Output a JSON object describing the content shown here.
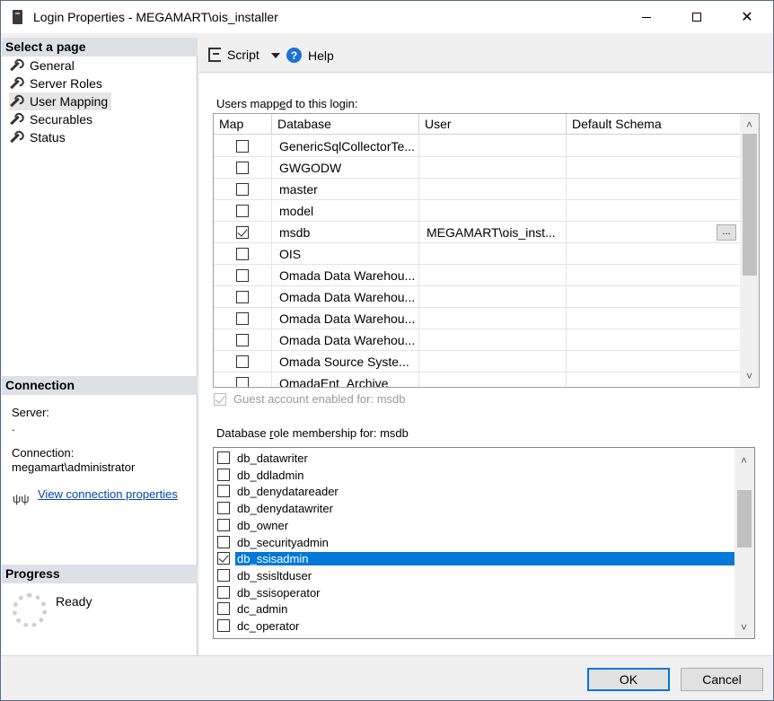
{
  "window": {
    "title": "Login Properties - MEGAMART\\ois_installer"
  },
  "left": {
    "select_page_header": "Select a page",
    "nav_items": [
      {
        "label": "General"
      },
      {
        "label": "Server Roles"
      },
      {
        "label": "User Mapping"
      },
      {
        "label": "Securables"
      },
      {
        "label": "Status"
      }
    ],
    "selected_nav": "User Mapping",
    "connection_header": "Connection",
    "server_label": "Server:",
    "server_value": ".",
    "connection_label": "Connection:",
    "connection_value": "megamart\\administrator",
    "view_connection_link": "View connection properties",
    "progress_header": "Progress",
    "progress_status": "Ready"
  },
  "toolbar": {
    "script_label": "Script",
    "help_label": "Help"
  },
  "mapping": {
    "label_pre": "Users mapp",
    "label_u": "e",
    "label_post": "d to this login:",
    "columns": [
      "Map",
      "Database",
      "User",
      "Default Schema"
    ],
    "rows": [
      {
        "checked": false,
        "database": "GenericSqlCollectorTe...",
        "user": "",
        "schema": ""
      },
      {
        "checked": false,
        "database": "GWGODW",
        "user": "",
        "schema": ""
      },
      {
        "checked": false,
        "database": "master",
        "user": "",
        "schema": ""
      },
      {
        "checked": false,
        "database": "model",
        "user": "",
        "schema": ""
      },
      {
        "checked": true,
        "database": "msdb",
        "user": "MEGAMART\\ois_inst...",
        "schema": "",
        "ellipsis": "..."
      },
      {
        "checked": false,
        "database": "OIS",
        "user": "",
        "schema": ""
      },
      {
        "checked": false,
        "database": "Omada Data Warehou...",
        "user": "",
        "schema": ""
      },
      {
        "checked": false,
        "database": "Omada Data Warehou...",
        "user": "",
        "schema": ""
      },
      {
        "checked": false,
        "database": "Omada Data Warehou...",
        "user": "",
        "schema": ""
      },
      {
        "checked": false,
        "database": "Omada Data Warehou...",
        "user": "",
        "schema": ""
      },
      {
        "checked": false,
        "database": "Omada Source Syste...",
        "user": "",
        "schema": ""
      },
      {
        "checked": false,
        "database": "OmadaEnt_Archive",
        "user": "",
        "schema": ""
      }
    ],
    "guest_label": "Guest account enabled for: msdb",
    "guest_checked": true
  },
  "roles": {
    "label_pre": "Database ",
    "label_u": "r",
    "label_post": "ole membership for: msdb",
    "items": [
      {
        "name": "db_datawriter",
        "checked": false
      },
      {
        "name": "db_ddladmin",
        "checked": false
      },
      {
        "name": "db_denydatareader",
        "checked": false
      },
      {
        "name": "db_denydatawriter",
        "checked": false
      },
      {
        "name": "db_owner",
        "checked": false
      },
      {
        "name": "db_securityadmin",
        "checked": false
      },
      {
        "name": "db_ssisadmin",
        "checked": true
      },
      {
        "name": "db_ssisltduser",
        "checked": false
      },
      {
        "name": "db_ssisoperator",
        "checked": false
      },
      {
        "name": "dc_admin",
        "checked": false
      },
      {
        "name": "dc_operator",
        "checked": false
      }
    ],
    "selected": "db_ssisadmin"
  },
  "footer": {
    "ok_label": "OK",
    "cancel_label": "Cancel"
  },
  "colors": {
    "accent": "#0078d7",
    "link": "#0645ad"
  },
  "icons": {
    "app": "server-icon",
    "nav": "wrench-icon",
    "script": "script-icon",
    "help": "help-icon",
    "connection": "plug-icon",
    "progress": "spinner-icon"
  }
}
